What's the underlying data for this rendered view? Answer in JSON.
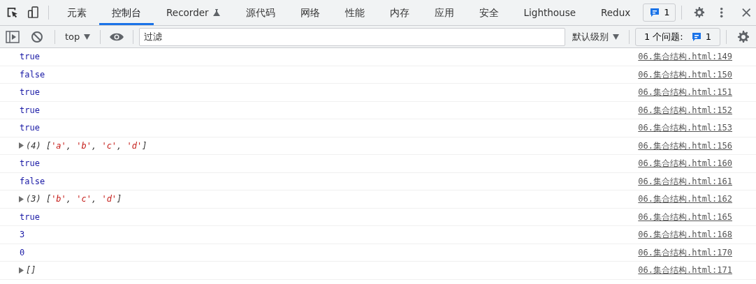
{
  "tabs": [
    {
      "label": "元素",
      "selected": false
    },
    {
      "label": "控制台",
      "selected": true
    },
    {
      "label": "Recorder",
      "selected": false,
      "flask": true
    },
    {
      "label": "源代码",
      "selected": false
    },
    {
      "label": "网络",
      "selected": false
    },
    {
      "label": "性能",
      "selected": false
    },
    {
      "label": "内存",
      "selected": false
    },
    {
      "label": "应用",
      "selected": false
    },
    {
      "label": "安全",
      "selected": false
    },
    {
      "label": "Lighthouse",
      "selected": false
    },
    {
      "label": "Redux",
      "selected": false
    }
  ],
  "issues_badge": "1",
  "toolbar": {
    "context": "top",
    "filter": {
      "placeholder": "过滤"
    },
    "levels": "默认级别",
    "issues_label": "1 个问题:",
    "issues_count": "1"
  },
  "messages": [
    {
      "kind": "value",
      "parts": [
        {
          "text": "true",
          "kind": "plain"
        }
      ],
      "source": "06.集合结构.html:149"
    },
    {
      "kind": "value",
      "parts": [
        {
          "text": "false",
          "kind": "plain"
        }
      ],
      "source": "06.集合结构.html:150"
    },
    {
      "kind": "value",
      "parts": [
        {
          "text": "true",
          "kind": "plain"
        }
      ],
      "source": "06.集合结构.html:151"
    },
    {
      "kind": "value",
      "parts": [
        {
          "text": "true",
          "kind": "plain"
        }
      ],
      "source": "06.集合结构.html:152"
    },
    {
      "kind": "value",
      "parts": [
        {
          "text": "true",
          "kind": "plain"
        }
      ],
      "source": "06.集合结构.html:153"
    },
    {
      "kind": "array",
      "expanded": false,
      "parts": [
        {
          "text": "(4) [",
          "kind": "punct"
        },
        {
          "text": "'a'",
          "kind": "string"
        },
        {
          "text": ", ",
          "kind": "punct"
        },
        {
          "text": "'b'",
          "kind": "string"
        },
        {
          "text": ", ",
          "kind": "punct"
        },
        {
          "text": "'c'",
          "kind": "string"
        },
        {
          "text": ", ",
          "kind": "punct"
        },
        {
          "text": "'d'",
          "kind": "string"
        },
        {
          "text": "]",
          "kind": "punct"
        }
      ],
      "source": "06.集合结构.html:156"
    },
    {
      "kind": "value",
      "parts": [
        {
          "text": "true",
          "kind": "plain"
        }
      ],
      "source": "06.集合结构.html:160"
    },
    {
      "kind": "value",
      "parts": [
        {
          "text": "false",
          "kind": "plain"
        }
      ],
      "source": "06.集合结构.html:161"
    },
    {
      "kind": "array",
      "expanded": false,
      "parts": [
        {
          "text": "(3) [",
          "kind": "punct"
        },
        {
          "text": "'b'",
          "kind": "string"
        },
        {
          "text": ", ",
          "kind": "punct"
        },
        {
          "text": "'c'",
          "kind": "string"
        },
        {
          "text": ", ",
          "kind": "punct"
        },
        {
          "text": "'d'",
          "kind": "string"
        },
        {
          "text": "]",
          "kind": "punct"
        }
      ],
      "source": "06.集合结构.html:162"
    },
    {
      "kind": "value",
      "parts": [
        {
          "text": "true",
          "kind": "plain"
        }
      ],
      "source": "06.集合结构.html:165"
    },
    {
      "kind": "value",
      "parts": [
        {
          "text": "3",
          "kind": "plain"
        }
      ],
      "source": "06.集合结构.html:168"
    },
    {
      "kind": "value",
      "parts": [
        {
          "text": "0",
          "kind": "plain"
        }
      ],
      "source": "06.集合结构.html:170"
    },
    {
      "kind": "array",
      "expanded": false,
      "parts": [
        {
          "text": "[]",
          "kind": "punct"
        }
      ],
      "source": "06.集合结构.html:171"
    }
  ]
}
